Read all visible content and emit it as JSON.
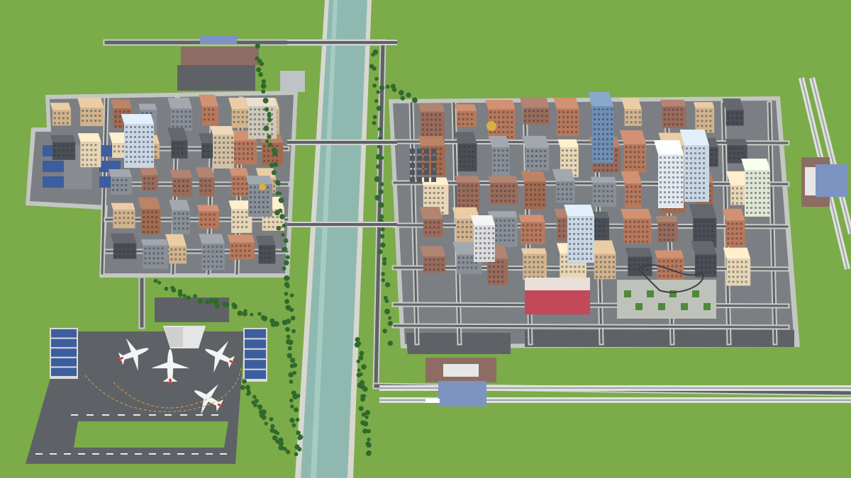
{
  "scene": {
    "description_name": "isometric-city-model",
    "colors": {
      "grass": "#7cab4a",
      "grass_dark": "#6d9a40",
      "canal_water": "#8fb9b0",
      "canal_edge": "#d8d8d0",
      "road": "#5e6266",
      "road_edge": "#c9ccc7",
      "asphalt_light": "#7b7f83",
      "tree": "#2f6a2c",
      "building_brick": "#b9785a",
      "building_cream": "#e8d6b4",
      "building_gray": "#8a8f96",
      "building_dark": "#4b4f55",
      "glass_blue": "#6f8fb3",
      "glass_light": "#c9d6e3",
      "roof_red": "#c2485a",
      "solar_blue": "#3d5e9e",
      "rail": "#9ea3a6",
      "plane_white": "#f4f4f4",
      "runway_mark": "#e9e9e9",
      "station_roof": "#7d93c2"
    },
    "airplanes": 4,
    "airport_present": true,
    "railway_present": true
  }
}
